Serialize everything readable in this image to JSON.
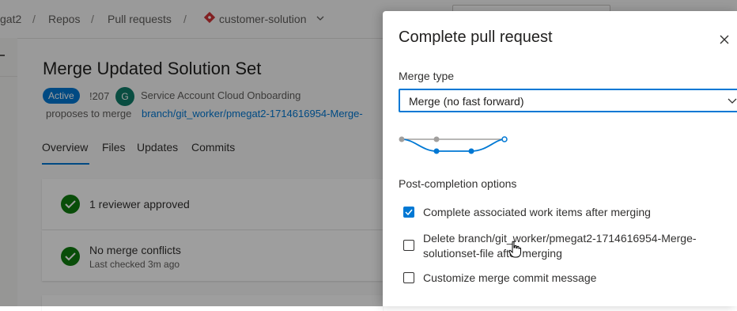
{
  "breadcrumbs": {
    "project": "gat2",
    "repos": "Repos",
    "pull_requests": "Pull requests",
    "repo": "customer-solution"
  },
  "pr": {
    "title": "Merge Updated Solution Set",
    "status": "Active",
    "id": "!207",
    "avatar_initial": "G",
    "author": "Service Account Cloud Onboarding",
    "proposes": "proposes to merge",
    "branch": "branch/git_worker/pmegat2-1714616954-Merge-"
  },
  "tabs": [
    "Overview",
    "Files",
    "Updates",
    "Commits"
  ],
  "checks": [
    {
      "text": "1 reviewer approved",
      "sub": ""
    },
    {
      "text": "No merge conflicts",
      "sub": "Last checked 3m ago"
    }
  ],
  "panel": {
    "title": "Complete pull request",
    "merge_type_label": "Merge type",
    "merge_type_value": "Merge (no fast forward)",
    "post_completion_label": "Post-completion options",
    "options": [
      {
        "label": "Complete associated work items after merging",
        "checked": true
      },
      {
        "label": "Delete branch/git_worker/pmegat2-1714616954-Merge-solutionset-file after merging",
        "checked": false
      },
      {
        "label": "Customize merge commit message",
        "checked": false
      }
    ]
  },
  "colors": {
    "accent": "#0078d4",
    "success": "#107c10",
    "avatar": "#107c6a",
    "repo_icon": "#d13438"
  }
}
